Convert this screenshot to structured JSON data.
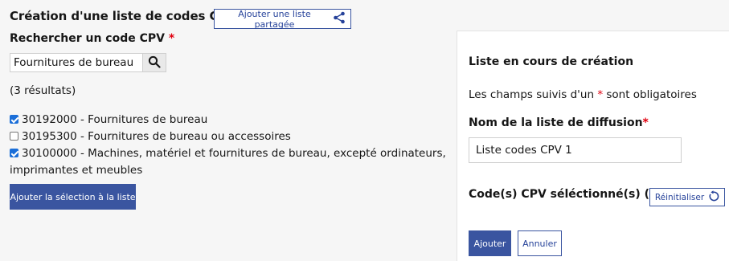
{
  "header": {
    "title": "Création d'une liste de codes CPV",
    "shared_button_label": "Ajouter une liste partagée",
    "shared_icon": "share-icon"
  },
  "search": {
    "label": "Rechercher un code CPV",
    "required_mark": "*",
    "value": "Fournitures de bureau",
    "search_icon": "search-icon"
  },
  "results": {
    "count_text": "(3 résultats)",
    "items": [
      {
        "label": "30192000 - Fournitures de bureau",
        "checked": true
      },
      {
        "label": "30195300 - Fournitures de bureau ou accessoires",
        "checked": false
      },
      {
        "label": "30100000 - Machines, matériel et fournitures de bureau, excepté ordinateurs, imprimantes et meubles",
        "checked": true
      }
    ],
    "add_selection_label": "Ajouter la sélection à la liste"
  },
  "panel": {
    "title": "Liste en cours de création",
    "note_prefix": "Les champs suivis d'un ",
    "note_mark": "*",
    "note_suffix": " sont obligatoires",
    "name_label": "Nom de la liste de diffusion",
    "name_required": "*",
    "name_value": "Liste codes CPV 1",
    "selected_codes_label": "Code(s) CPV séléctionné(s) (0)",
    "reset_label": "Réinitialiser",
    "reset_icon": "reset-icon",
    "add_label": "Ajouter",
    "cancel_label": "Annuler"
  },
  "colors": {
    "primary": "#3a55a0",
    "required": "#e1000f",
    "checkbox": "#1a6ed8"
  }
}
